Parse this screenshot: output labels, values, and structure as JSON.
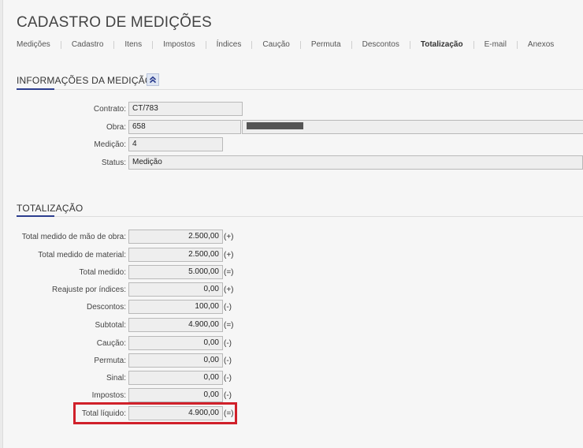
{
  "page": {
    "title": "CADASTRO DE MEDIÇÕES"
  },
  "tabs": [
    {
      "label": "Medições",
      "active": false
    },
    {
      "label": "Cadastro",
      "active": false
    },
    {
      "label": "Itens",
      "active": false
    },
    {
      "label": "Impostos",
      "active": false
    },
    {
      "label": "Índices",
      "active": false
    },
    {
      "label": "Caução",
      "active": false
    },
    {
      "label": "Permuta",
      "active": false
    },
    {
      "label": "Descontos",
      "active": false
    },
    {
      "label": "Totalização",
      "active": true
    },
    {
      "label": "E-mail",
      "active": false
    },
    {
      "label": "Anexos",
      "active": false
    }
  ],
  "info": {
    "title": "INFORMAÇÕES DA MEDIÇÃO",
    "collapse_icon": "double-chevron-up-icon",
    "contrato_label": "Contrato:",
    "contrato_value": "CT/783",
    "obra_label": "Obra:",
    "obra_value": "658",
    "medicao_label": "Medição:",
    "medicao_value": "4",
    "status_label": "Status:",
    "status_value": "Medição"
  },
  "totalizacao": {
    "title": "TOTALIZAÇÃO",
    "rows": [
      {
        "label": "Total medido de mão de obra:",
        "value": "2.500,00",
        "op": "(+)"
      },
      {
        "label": "Total medido de material:",
        "value": "2.500,00",
        "op": "(+)"
      },
      {
        "label": "Total medido:",
        "value": "5.000,00",
        "op": "(=)"
      },
      {
        "label": "Reajuste por índices:",
        "value": "0,00",
        "op": "(+)"
      },
      {
        "label": "Descontos:",
        "value": "100,00",
        "op": "(-)"
      },
      {
        "label": "Subtotal:",
        "value": "4.900,00",
        "op": "(=)"
      },
      {
        "label": "Caução:",
        "value": "0,00",
        "op": "(-)"
      },
      {
        "label": "Permuta:",
        "value": "0,00",
        "op": "(-)"
      },
      {
        "label": "Sinal:",
        "value": "0,00",
        "op": "(-)"
      },
      {
        "label": "Impostos:",
        "value": "0,00",
        "op": "(-)"
      },
      {
        "label": "Total líquido:",
        "value": "4.900,00",
        "op": "(=)"
      }
    ]
  },
  "colors": {
    "accent": "#2c3e8f",
    "highlight": "#d0202a",
    "field_bg": "#eeeeee"
  }
}
